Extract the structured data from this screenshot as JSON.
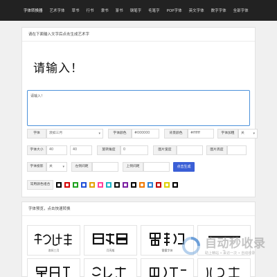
{
  "nav": [
    "字体转换器",
    "艺术字体",
    "草书",
    "行书",
    "隶书",
    "篆书",
    "钢笔字",
    "毛笔字",
    "POP字体",
    "英文字体",
    "数字字体",
    "全部字体"
  ],
  "panel1": {
    "title": "请在下面输入文字后点击生成艺术字",
    "preview_text": "请输入！",
    "textarea_value": "请输入！"
  },
  "form": {
    "font_label": "字体",
    "font_value": "浪如三月",
    "color_label": "字体颜色",
    "color_value": "#000000",
    "bg_label": "背景颜色",
    "bg_value": "#ffffff",
    "bold_label": "字体加粗",
    "bold_value": "关",
    "size_label": "字体大小",
    "size_value": "40",
    "size_value2": "40",
    "rotate_label": "旋转角度",
    "rotate_value": "0",
    "width_label": "图片宽度",
    "height_label": "图片高度",
    "shadow_label": "字体投影",
    "shadow_value": "关",
    "lr_label": "左侧间距",
    "ud_label": "上侧间距",
    "generate_label": "点击生成",
    "palette_label": "常用颜色组合",
    "palette": [
      "#000000",
      "#d40000",
      "#1ea21e",
      "#1f4fd8",
      "#e3a000",
      "#ff3f9a",
      "#1bb3c6",
      "#111111",
      "#7b1fa2",
      "#000000",
      "#f07800",
      "#2a7fd4",
      "#c00000",
      "#e0d000",
      "#000000"
    ]
  },
  "panel2": {
    "title": "字体预览，点击快速转换",
    "cards": [
      {
        "name": "浪如三月"
      },
      {
        "name": "月亮般"
      },
      {
        "name": "雷霆字体"
      },
      {
        "name": "一"
      }
    ]
  },
  "watermark": {
    "title": "自动秒收录",
    "sub": "助上精站 • 来访一次 • 自动收录"
  }
}
